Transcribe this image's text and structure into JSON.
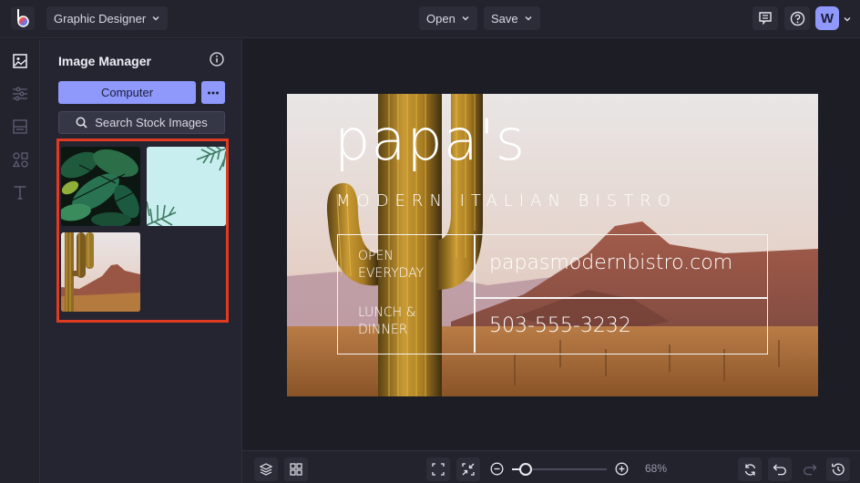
{
  "topbar": {
    "mode_label": "Graphic Designer",
    "open_label": "Open",
    "save_label": "Save",
    "avatar_initial": "W"
  },
  "rail": {
    "items": [
      {
        "name": "image-manager",
        "active": true
      },
      {
        "name": "adjustments",
        "active": false
      },
      {
        "name": "backgrounds",
        "active": false
      },
      {
        "name": "graphics",
        "active": false
      },
      {
        "name": "text",
        "active": false
      }
    ]
  },
  "panel": {
    "title": "Image Manager",
    "computer_label": "Computer",
    "more_label": "•••",
    "search_label": "Search Stock Images",
    "thumbnails": [
      {
        "name": "monstera-leaves"
      },
      {
        "name": "palm-fronds-sky"
      },
      {
        "name": "saguaro-desert"
      }
    ]
  },
  "artboard": {
    "title": "papa's",
    "subtitle": "MODERN ITALIAN BISTRO",
    "info": {
      "hours_line1": "OPEN",
      "hours_line2": "EVERYDAY",
      "meals_line1": "LUNCH &",
      "meals_line2": "DINNER",
      "website": "papasmodernbistro.com",
      "phone": "503-555-3232"
    }
  },
  "bottombar": {
    "zoom_percent": "68%",
    "zoom_level": 0.14
  },
  "colors": {
    "accent": "#8f99fb",
    "selection": "#e03a22",
    "background": "#1d1e26"
  }
}
